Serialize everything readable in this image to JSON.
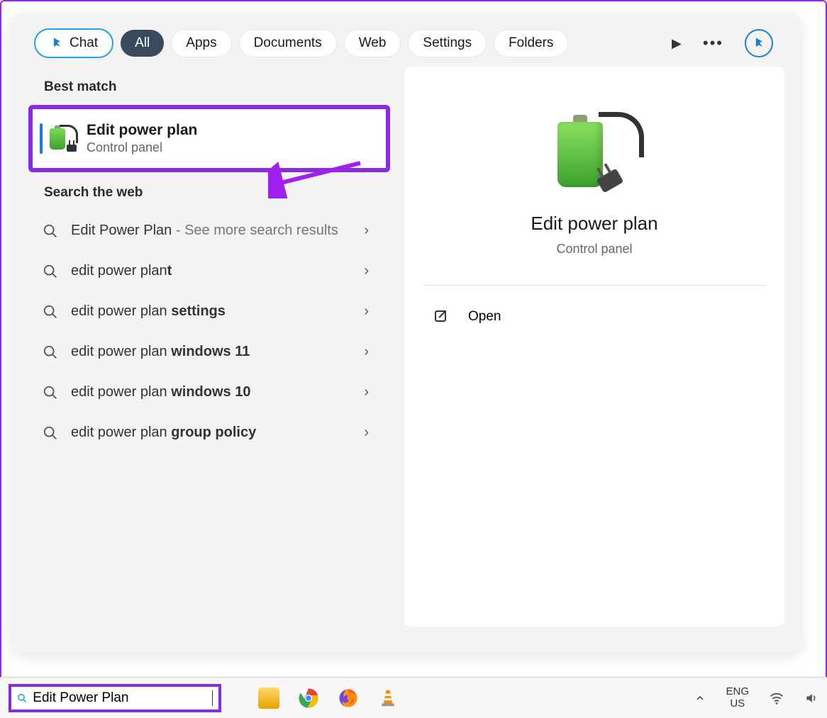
{
  "tabs": {
    "chat": "Chat",
    "all": "All",
    "apps": "Apps",
    "documents": "Documents",
    "web": "Web",
    "settings": "Settings",
    "folders": "Folders"
  },
  "left": {
    "best_match_header": "Best match",
    "best_match": {
      "title": "Edit power plan",
      "subtitle": "Control panel"
    },
    "search_web_header": "Search the web",
    "web_items": [
      {
        "prefix": "Edit Power Plan",
        "suffix": " - See more search results",
        "bold_suffix": ""
      },
      {
        "prefix": "edit power plan",
        "suffix": "",
        "bold_suffix": "t"
      },
      {
        "prefix": "edit power plan ",
        "suffix": "",
        "bold_suffix": "settings"
      },
      {
        "prefix": "edit power plan ",
        "suffix": "",
        "bold_suffix": "windows 11"
      },
      {
        "prefix": "edit power plan ",
        "suffix": "",
        "bold_suffix": "windows 10"
      },
      {
        "prefix": "edit power plan ",
        "suffix": "",
        "bold_suffix": "group policy"
      }
    ]
  },
  "right": {
    "title": "Edit power plan",
    "subtitle": "Control panel",
    "actions": {
      "open": "Open"
    }
  },
  "taskbar": {
    "search_value": "Edit Power Plan",
    "lang_top": "ENG",
    "lang_bottom": "US"
  }
}
